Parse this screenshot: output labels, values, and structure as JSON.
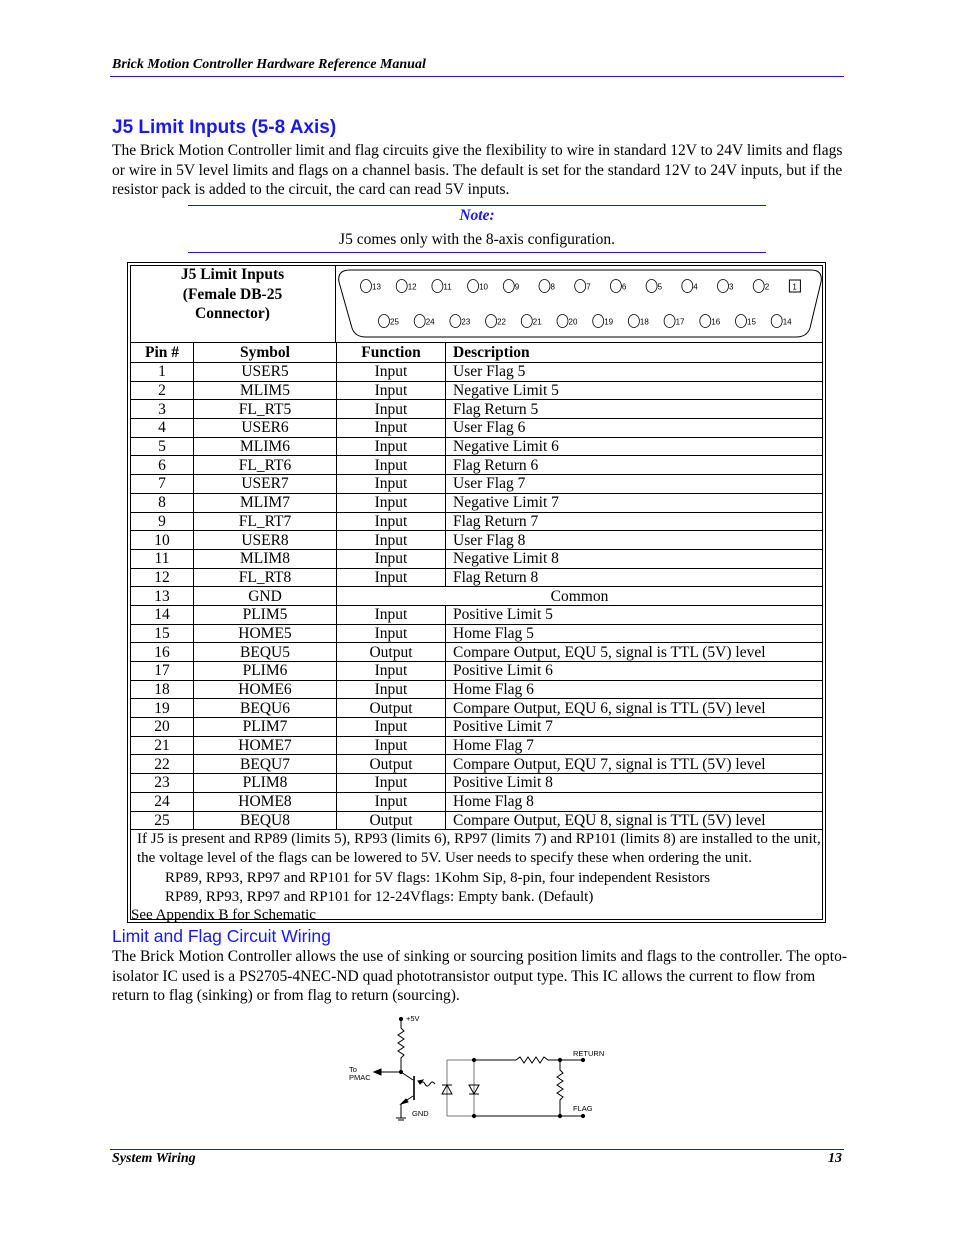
{
  "header": {
    "title": "Brick Motion Controller Hardware Reference Manual"
  },
  "section": {
    "title": "J5 Limit Inputs (5-8 Axis)",
    "paragraph": "The Brick Motion Controller limit and flag circuits give the flexibility to wire in standard 12V to 24V limits and flags or wire in 5V level limits and flags on a channel basis.  The default is set for the standard 12V to 24V inputs, but if the resistor pack is added to the circuit, the card can read 5V inputs."
  },
  "note": {
    "title": "Note:",
    "text": "J5 comes only with the 8-axis configuration."
  },
  "connector": {
    "title_lines": [
      "J5 Limit Inputs",
      "(Female DB-25",
      "Connector)"
    ],
    "top_row_pins": [
      "13",
      "12",
      "11",
      "10",
      "9",
      "8",
      "7",
      "6",
      "5",
      "4",
      "3",
      "2",
      "1"
    ],
    "bottom_row_pins": [
      "25",
      "24",
      "23",
      "22",
      "21",
      "20",
      "19",
      "18",
      "17",
      "16",
      "15",
      "14"
    ]
  },
  "table": {
    "headers": {
      "pin": "Pin #",
      "symbol": "Symbol",
      "function": "Function",
      "description": "Description"
    },
    "rows": [
      {
        "pin": "1",
        "symbol": "USER5",
        "function": "Input",
        "description": "User Flag 5"
      },
      {
        "pin": "2",
        "symbol": "MLIM5",
        "function": "Input",
        "description": "Negative Limit 5"
      },
      {
        "pin": "3",
        "symbol": "FL_RT5",
        "function": "Input",
        "description": "Flag Return 5"
      },
      {
        "pin": "4",
        "symbol": "USER6",
        "function": "Input",
        "description": "User Flag 6"
      },
      {
        "pin": "5",
        "symbol": "MLIM6",
        "function": "Input",
        "description": "Negative Limit 6"
      },
      {
        "pin": "6",
        "symbol": "FL_RT6",
        "function": "Input",
        "description": "Flag Return 6"
      },
      {
        "pin": "7",
        "symbol": "USER7",
        "function": "Input",
        "description": "User Flag 7"
      },
      {
        "pin": "8",
        "symbol": "MLIM7",
        "function": "Input",
        "description": "Negative Limit 7"
      },
      {
        "pin": "9",
        "symbol": "FL_RT7",
        "function": "Input",
        "description": "Flag Return 7"
      },
      {
        "pin": "10",
        "symbol": "USER8",
        "function": "Input",
        "description": "User Flag 8"
      },
      {
        "pin": "11",
        "symbol": "MLIM8",
        "function": "Input",
        "description": "Negative Limit 8"
      },
      {
        "pin": "12",
        "symbol": "FL_RT8",
        "function": "Input",
        "description": "Flag Return 8"
      },
      {
        "pin": "13",
        "symbol": "GND",
        "function": "",
        "description": "Common",
        "merged": true
      },
      {
        "pin": "14",
        "symbol": "PLIM5",
        "function": "Input",
        "description": "Positive Limit 5"
      },
      {
        "pin": "15",
        "symbol": "HOME5",
        "function": "Input",
        "description": "Home Flag 5"
      },
      {
        "pin": "16",
        "symbol": "BEQU5",
        "function": "Output",
        "description": "Compare Output, EQU 5, signal is TTL (5V) level"
      },
      {
        "pin": "17",
        "symbol": "PLIM6",
        "function": "Input",
        "description": "Positive Limit 6"
      },
      {
        "pin": "18",
        "symbol": "HOME6",
        "function": "Input",
        "description": "Home Flag 6"
      },
      {
        "pin": "19",
        "symbol": "BEQU6",
        "function": "Output",
        "description": "Compare Output, EQU 6, signal is TTL (5V) level"
      },
      {
        "pin": "20",
        "symbol": "PLIM7",
        "function": "Input",
        "description": "Positive Limit 7"
      },
      {
        "pin": "21",
        "symbol": "HOME7",
        "function": "Input",
        "description": "Home Flag 7"
      },
      {
        "pin": "22",
        "symbol": "BEQU7",
        "function": "Output",
        "description": "Compare Output, EQU 7, signal is TTL (5V) level"
      },
      {
        "pin": "23",
        "symbol": "PLIM8",
        "function": "Input",
        "description": "Positive Limit 8"
      },
      {
        "pin": "24",
        "symbol": "HOME8",
        "function": "Input",
        "description": "Home Flag 8"
      },
      {
        "pin": "25",
        "symbol": "BEQU8",
        "function": "Output",
        "description": "Compare Output, EQU 8, signal is TTL (5V) level"
      }
    ],
    "footnote": {
      "paragraph": "If J5 is present and RP89 (limits 5), RP93 (limits 6), RP97 (limits 7) and RP101 (limits 8) are installed to the unit, the voltage level of the flags can be lowered to 5V. User needs to specify these when ordering the unit.",
      "line_5v": "RP89, RP93, RP97 and RP101 for 5V flags: 1Kohm Sip, 8-pin, four independent Resistors",
      "line_24v": "RP89, RP93, RP97 and RP101 for 12-24Vflags: Empty bank. (Default)",
      "see_also": "See Appendix B for Schematic"
    }
  },
  "subsection": {
    "title": "Limit and Flag Circuit Wiring",
    "paragraph": "The Brick Motion Controller allows the use of sinking or sourcing position limits and flags to the controller.  The opto-isolator IC used is a PS2705-4NEC-ND quad phototransistor output type.  This IC allows the current to flow from return to flag (sinking) or from flag to return (sourcing)."
  },
  "circuit": {
    "labels": {
      "supply": "+5V",
      "to": "To",
      "pmac": "PMAC",
      "gnd": "GND",
      "return": "RETURN",
      "flag": "FLAG"
    }
  },
  "footer": {
    "left": "System Wiring",
    "page": "13"
  }
}
